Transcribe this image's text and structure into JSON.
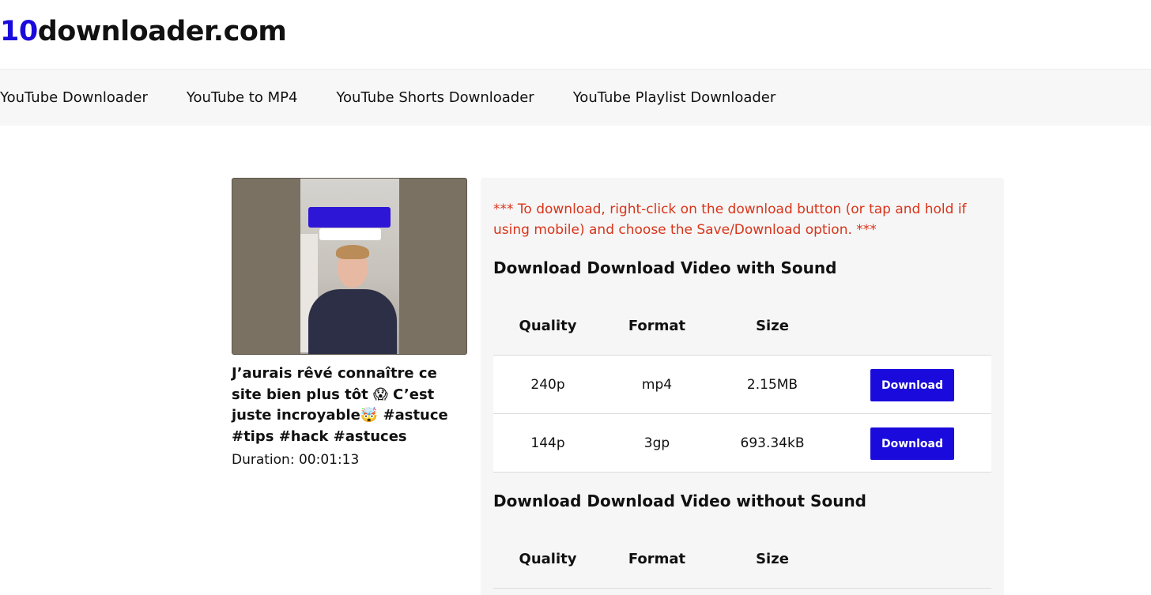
{
  "site": {
    "logo_accent": "10",
    "logo_rest": "downloader.com"
  },
  "nav": [
    {
      "label": "YouTube Downloader"
    },
    {
      "label": "YouTube to MP4"
    },
    {
      "label": "YouTube Shorts Downloader"
    },
    {
      "label": "YouTube Playlist Downloader"
    }
  ],
  "video": {
    "title": "J’aurais rêvé connaître ce site bien plus tôt 😱 C’est juste incroyable🤯 #astuce #tips #hack #astuces",
    "duration": "Duration: 00:01:13"
  },
  "notice": "*** To download, right-click on the download button (or tap and hold if using mobile) and choose the Save/Download option. ***",
  "with_sound": {
    "title": "Download Download Video with Sound",
    "headers": {
      "quality": "Quality",
      "format": "Format",
      "size": "Size"
    },
    "rows": [
      {
        "quality": "240p",
        "format": "mp4",
        "size": "2.15MB",
        "button": "Download"
      },
      {
        "quality": "144p",
        "format": "3gp",
        "size": "693.34kB",
        "button": "Download"
      }
    ]
  },
  "without_sound": {
    "title": "Download Download Video without Sound",
    "headers": {
      "quality": "Quality",
      "format": "Format",
      "size": "Size"
    }
  },
  "colors": {
    "accent": "#1a0bdc",
    "notice": "#d9341a",
    "nav_bg": "#f7f7f7",
    "card_bg": "#f6f6f6"
  }
}
